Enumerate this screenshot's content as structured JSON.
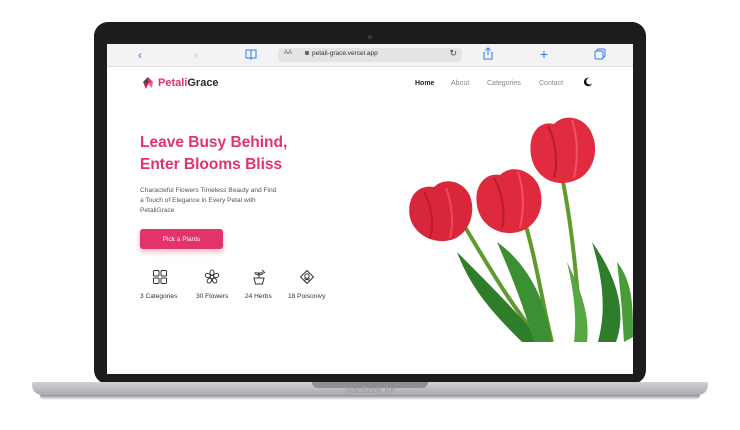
{
  "browser": {
    "text_size_label": "AA",
    "url": "petali-grace.vercel.app"
  },
  "site": {
    "logo_part1": "Petali",
    "logo_part2": "Grace",
    "brand_color": "#e2336b"
  },
  "nav": {
    "items": [
      "Home",
      "About",
      "Categories",
      "Contact"
    ],
    "active": "Home",
    "theme_toggle_icon": "moon-icon"
  },
  "hero": {
    "headline_line1": "Leave Busy Behind,",
    "headline_line2": "Enter Blooms Bliss",
    "subtitle": "Characteful Flowers Timeless Beauty and Find a Touch of Elegance in Every Petal with PetaliGrace",
    "cta_label": "Pick a Plants"
  },
  "stats": [
    {
      "icon": "grid-icon",
      "label": "3 Categories"
    },
    {
      "icon": "flower-icon",
      "label": "30 Flowers"
    },
    {
      "icon": "herb-pot-icon",
      "label": "24 Herbs"
    },
    {
      "icon": "poison-icon",
      "label": "18 Poisonivy"
    }
  ],
  "device": {
    "label": "MacBook Air"
  }
}
